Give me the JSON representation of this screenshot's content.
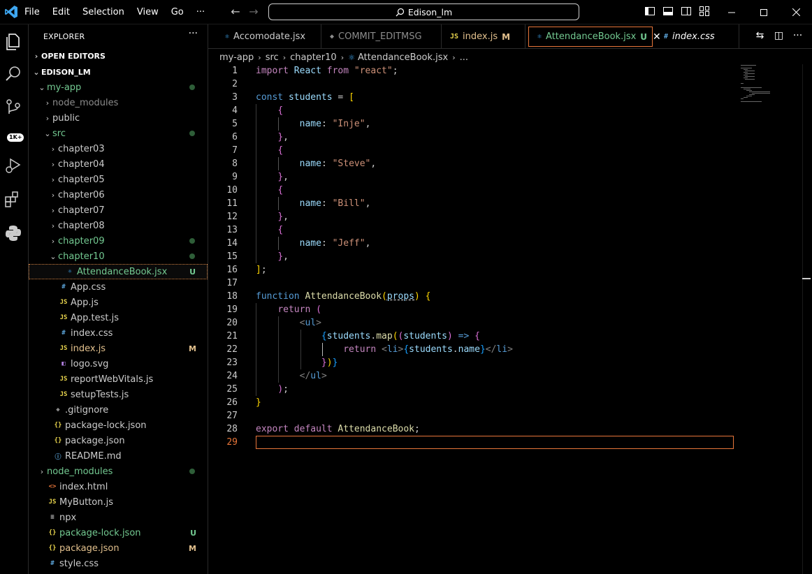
{
  "titlebar": {
    "menu": [
      "File",
      "Edit",
      "Selection",
      "View",
      "Go",
      "···"
    ],
    "search_text": "Edison_lm"
  },
  "activity": {
    "badge": "1K+"
  },
  "sidebar": {
    "header": "EXPLORER",
    "more": "···",
    "open_editors": "OPEN EDITORS",
    "root": "EDISON_LM",
    "items": [
      {
        "label": "my-app",
        "icon": "",
        "chev": "⌄",
        "color": "#73c991",
        "mark": "dot"
      },
      {
        "label": "node_modules",
        "icon": "",
        "chev": "›",
        "color": "#8c8c8c",
        "mark": ""
      },
      {
        "label": "public",
        "icon": "",
        "chev": "›",
        "color": "#cccccc",
        "mark": ""
      },
      {
        "label": "src",
        "icon": "",
        "chev": "⌄",
        "color": "#73c991",
        "mark": "dot"
      },
      {
        "label": "chapter03",
        "icon": "",
        "chev": "›",
        "color": "#cccccc",
        "mark": ""
      },
      {
        "label": "chapter04",
        "icon": "",
        "chev": "›",
        "color": "#cccccc",
        "mark": ""
      },
      {
        "label": "chapter05",
        "icon": "",
        "chev": "›",
        "color": "#cccccc",
        "mark": ""
      },
      {
        "label": "chapter06",
        "icon": "",
        "chev": "›",
        "color": "#cccccc",
        "mark": ""
      },
      {
        "label": "chapter07",
        "icon": "",
        "chev": "›",
        "color": "#cccccc",
        "mark": ""
      },
      {
        "label": "chapter08",
        "icon": "",
        "chev": "›",
        "color": "#cccccc",
        "mark": ""
      },
      {
        "label": "chapter09",
        "icon": "",
        "chev": "›",
        "color": "#73c991",
        "mark": "dot"
      },
      {
        "label": "chapter10",
        "icon": "",
        "chev": "⌄",
        "color": "#73c991",
        "mark": "dot"
      },
      {
        "label": "AttendanceBook.jsx",
        "icon": "⚛",
        "chev": "",
        "color": "#73c991",
        "mark": "U"
      },
      {
        "label": "App.css",
        "icon": "#",
        "chev": "",
        "color": "#cccccc",
        "mark": ""
      },
      {
        "label": "App.js",
        "icon": "JS",
        "chev": "",
        "color": "#cccccc",
        "mark": ""
      },
      {
        "label": "App.test.js",
        "icon": "JS",
        "chev": "",
        "color": "#cccccc",
        "mark": ""
      },
      {
        "label": "index.css",
        "icon": "#",
        "chev": "",
        "color": "#cccccc",
        "mark": ""
      },
      {
        "label": "index.js",
        "icon": "JS",
        "chev": "",
        "color": "#e2c08d",
        "mark": "M"
      },
      {
        "label": "logo.svg",
        "icon": "◧",
        "chev": "",
        "color": "#cccccc",
        "mark": ""
      },
      {
        "label": "reportWebVitals.js",
        "icon": "JS",
        "chev": "",
        "color": "#cccccc",
        "mark": ""
      },
      {
        "label": "setupTests.js",
        "icon": "JS",
        "chev": "",
        "color": "#cccccc",
        "mark": ""
      },
      {
        "label": ".gitignore",
        "icon": "◆",
        "chev": "",
        "color": "#cccccc",
        "mark": ""
      },
      {
        "label": "package-lock.json",
        "icon": "{}",
        "chev": "",
        "color": "#cccccc",
        "mark": ""
      },
      {
        "label": "package.json",
        "icon": "{}",
        "chev": "",
        "color": "#cccccc",
        "mark": ""
      },
      {
        "label": "README.md",
        "icon": "ⓘ",
        "chev": "",
        "color": "#cccccc",
        "mark": ""
      },
      {
        "label": "node_modules",
        "icon": "",
        "chev": "›",
        "color": "#73c991",
        "mark": "dot"
      },
      {
        "label": "index.html",
        "icon": "<>",
        "chev": "",
        "color": "#cccccc",
        "mark": ""
      },
      {
        "label": "MyButton.js",
        "icon": "JS",
        "chev": "",
        "color": "#cccccc",
        "mark": ""
      },
      {
        "label": "npx",
        "icon": "≡",
        "chev": "",
        "color": "#cccccc",
        "mark": ""
      },
      {
        "label": "package-lock.json",
        "icon": "{}",
        "chev": "",
        "color": "#73c991",
        "mark": "U"
      },
      {
        "label": "package.json",
        "icon": "{}",
        "chev": "",
        "color": "#e2c08d",
        "mark": "M"
      },
      {
        "label": "style.css",
        "icon": "#",
        "chev": "",
        "color": "#cccccc",
        "mark": ""
      }
    ]
  },
  "tabs": [
    {
      "label": "Accomodate.jsx",
      "icon": "⚛",
      "status": "",
      "color": "#cccccc"
    },
    {
      "label": "COMMIT_EDITMSG",
      "icon": "◆",
      "status": "",
      "color": "#8c8c8c"
    },
    {
      "label": "index.js",
      "icon": "JS",
      "status": "M",
      "color": "#e2c08d"
    },
    {
      "label": "AttendanceBook.jsx",
      "icon": "⚛",
      "status": "U",
      "color": "#73c991"
    },
    {
      "label": "index.css",
      "icon": "#",
      "status": "",
      "color": "#cccccc"
    }
  ],
  "breadcrumb": [
    "my-app",
    "src",
    "chapter10",
    "AttendanceBook.jsx",
    "..."
  ],
  "editor": {
    "current_line": 29,
    "line_count": 29
  },
  "colors": {
    "accent": "#e8763a",
    "git_untracked": "#73c991",
    "git_modified": "#e2c08d"
  }
}
